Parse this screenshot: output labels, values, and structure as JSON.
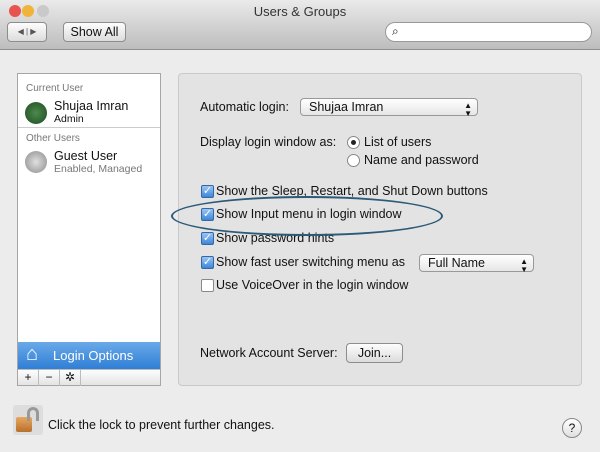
{
  "window": {
    "title": "Users & Groups"
  },
  "toolbar": {
    "back": "◀",
    "forward": "▶",
    "show_all": "Show All",
    "search_placeholder": ""
  },
  "sidebar": {
    "current_user_header": "Current User",
    "current_user": {
      "name": "Shujaa Imran",
      "role": "Admin"
    },
    "other_users_header": "Other Users",
    "other_users": [
      {
        "name": "Guest User",
        "status": "Enabled, Managed"
      }
    ],
    "login_options": "Login Options",
    "add": "+",
    "remove": "−",
    "action": "✲"
  },
  "panel": {
    "automatic_login_label": "Automatic login:",
    "automatic_login_value": "Shujaa Imran",
    "display_login_label": "Display login window as:",
    "display_options": [
      {
        "label": "List of users",
        "selected": true
      },
      {
        "label": "Name and password",
        "selected": false
      }
    ],
    "checkboxes": [
      {
        "label": "Show the Sleep, Restart, and Shut Down buttons",
        "checked": true
      },
      {
        "label": "Show Input menu in login window",
        "checked": true
      },
      {
        "label": "Show password hints",
        "checked": true
      },
      {
        "label": "Show fast user switching menu as",
        "checked": true
      },
      {
        "label": "Use VoiceOver in the login window",
        "checked": false
      }
    ],
    "fast_switch_value": "Full Name",
    "network_label": "Network Account Server:",
    "join": "Join..."
  },
  "footer": {
    "lock_text": "Click the lock to prevent further changes.",
    "help": "?"
  }
}
